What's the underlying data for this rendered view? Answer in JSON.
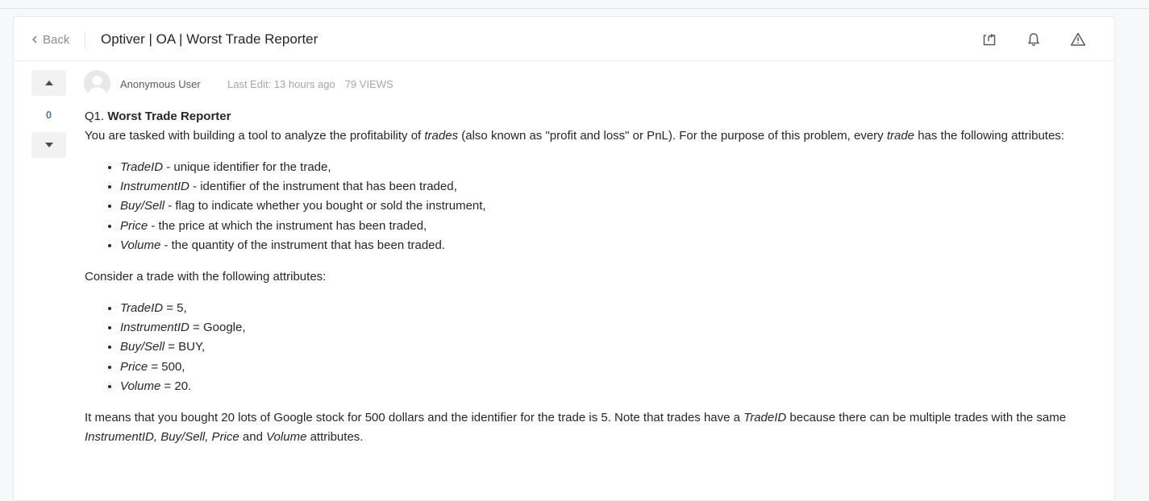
{
  "header": {
    "back_label": "Back",
    "title": "Optiver | OA | Worst Trade Reporter",
    "icons": [
      "share-icon",
      "bell-icon",
      "warning-icon"
    ]
  },
  "post": {
    "vote_count": "0",
    "author": "Anonymous User",
    "last_edit": "Last Edit: 13 hours ago",
    "views": "79 VIEWS"
  },
  "content": {
    "q_prefix": "Q1.",
    "q_title": "Worst Trade Reporter",
    "intro_1": "You are tasked with building a tool to analyze the profitability of ",
    "intro_trades": "trades",
    "intro_2": " (also known as \"profit and loss\" or PnL). For the purpose of this problem, every ",
    "intro_trade": "trade",
    "intro_3": " has the following attributes:",
    "attributes": [
      {
        "name": "TradeID",
        "desc": " - unique identifier for the trade,"
      },
      {
        "name": "InstrumentID",
        "desc": " - identifier of the instrument that has been traded,"
      },
      {
        "name": "Buy/Sell",
        "desc": " - flag to indicate whether you bought or sold the instrument,"
      },
      {
        "name": "Price",
        "desc": " - the price at which the instrument has been traded,"
      },
      {
        "name": "Volume",
        "desc": " - the quantity of the instrument that has been traded."
      }
    ],
    "consider": "Consider a trade with the following attributes:",
    "example": [
      {
        "name": "TradeID",
        "desc": " = 5,"
      },
      {
        "name": "InstrumentID",
        "desc": " = Google,"
      },
      {
        "name": "Buy/Sell",
        "desc": " = BUY,"
      },
      {
        "name": "Price",
        "desc": " = 500,"
      },
      {
        "name": "Volume",
        "desc": " = 20."
      }
    ],
    "means_1": "It means that you bought 20 lots of Google stock for 500 dollars and the identifier for the trade is 5. Note that trades have a ",
    "means_tradeid": "TradeID",
    "means_2": " because there can be multiple trades with the same ",
    "means_fields": "InstrumentID, Buy/Sell, Price",
    "means_and": " and ",
    "means_volume": "Volume",
    "means_3": " attributes."
  }
}
